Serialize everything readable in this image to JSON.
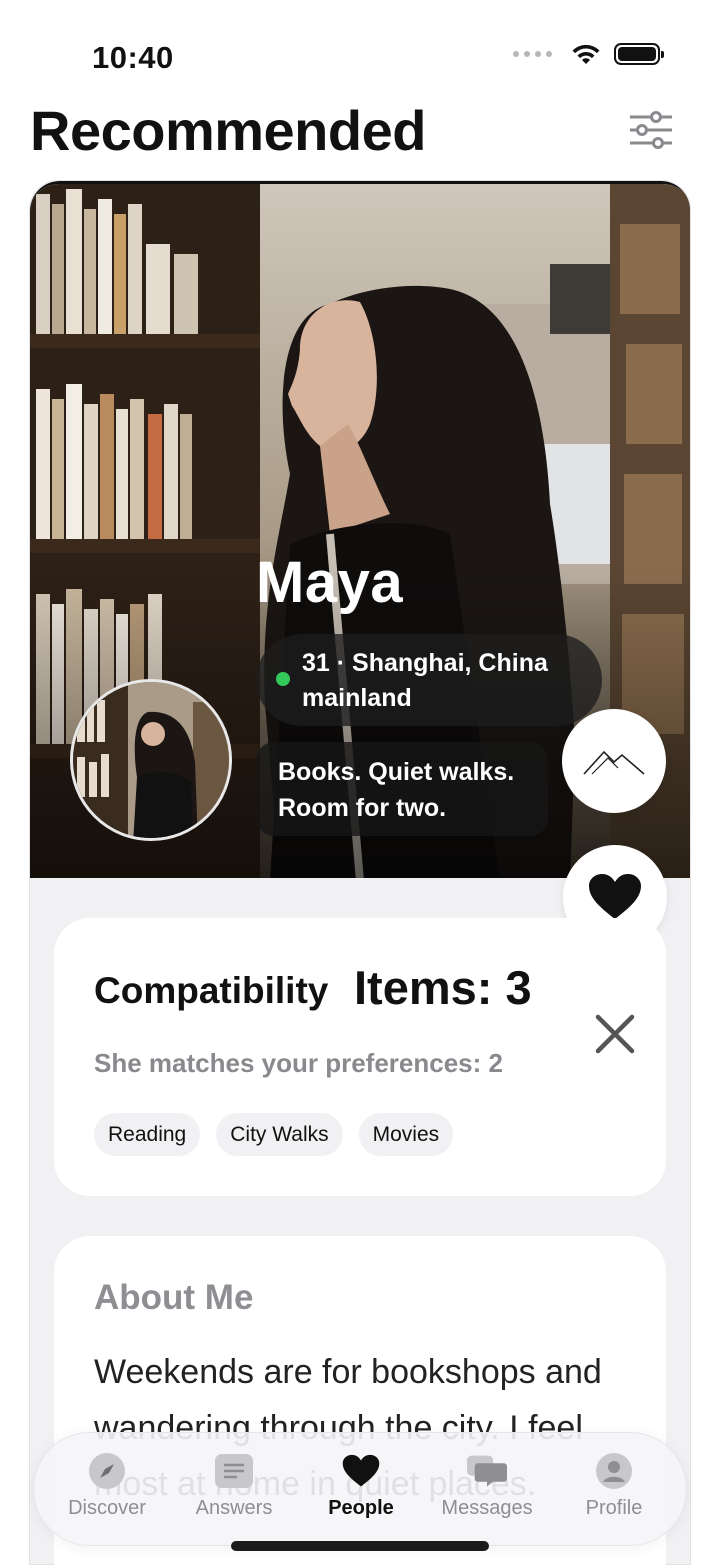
{
  "status_bar": {
    "time": "10:40"
  },
  "header": {
    "title": "Recommended"
  },
  "profile": {
    "name": "Maya",
    "info": "31 · Shanghai,  China mainland",
    "bio": "Books. Quiet walks. Room for two."
  },
  "compatibility": {
    "title": "Compatibility",
    "items_label": "Items: 3",
    "subtitle": "She matches your preferences: 2",
    "tags": [
      "Reading",
      "City Walks",
      "Movies"
    ]
  },
  "about": {
    "title": "About Me",
    "text": "Weekends are for bookshops and wandering through the city. I feel most at home in quiet places."
  },
  "tab_bar": {
    "tabs": [
      {
        "label": "Discover",
        "icon": "compass-icon"
      },
      {
        "label": "Answers",
        "icon": "answers-icon"
      },
      {
        "label": "People",
        "icon": "heart-icon"
      },
      {
        "label": "Messages",
        "icon": "chat-bubbles-icon"
      },
      {
        "label": "Profile",
        "icon": "person-icon"
      }
    ],
    "active": "People"
  },
  "colors": {
    "online": "#34c759",
    "accent": "#111111",
    "muted": "#8e8e93"
  }
}
